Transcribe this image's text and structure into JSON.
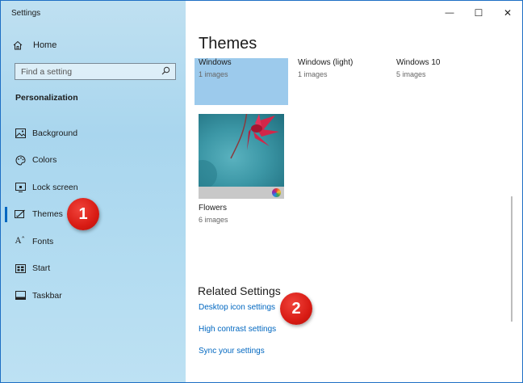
{
  "app": {
    "title": "Settings"
  },
  "sidebar": {
    "home_label": "Home",
    "search": {
      "placeholder": "Find a setting"
    },
    "section_title": "Personalization",
    "items": [
      {
        "label": "Background",
        "icon": "picture-icon"
      },
      {
        "label": "Colors",
        "icon": "palette-icon"
      },
      {
        "label": "Lock screen",
        "icon": "lock-screen-icon"
      },
      {
        "label": "Themes",
        "icon": "themes-icon",
        "active": true
      },
      {
        "label": "Fonts",
        "icon": "fonts-icon"
      },
      {
        "label": "Start",
        "icon": "start-icon"
      },
      {
        "label": "Taskbar",
        "icon": "taskbar-icon"
      }
    ]
  },
  "window_controls": {
    "minimize": "—",
    "maximize": "☐",
    "close": "✕"
  },
  "main": {
    "title": "Themes",
    "themes": [
      {
        "name": "Windows",
        "count": "1 images",
        "selected": true
      },
      {
        "name": "Windows (light)",
        "count": "1 images"
      },
      {
        "name": "Windows 10",
        "count": "5 images"
      },
      {
        "name": "Flowers",
        "count": "6 images"
      }
    ],
    "related": {
      "title": "Related Settings",
      "links": [
        "Desktop icon settings",
        "High contrast settings",
        "Sync your settings"
      ]
    }
  },
  "annotations": {
    "badge1": "1",
    "badge2": "2"
  },
  "colors": {
    "accent": "#0067c0",
    "selected_tile": "#9ccaec",
    "badge": "#d81b14"
  }
}
